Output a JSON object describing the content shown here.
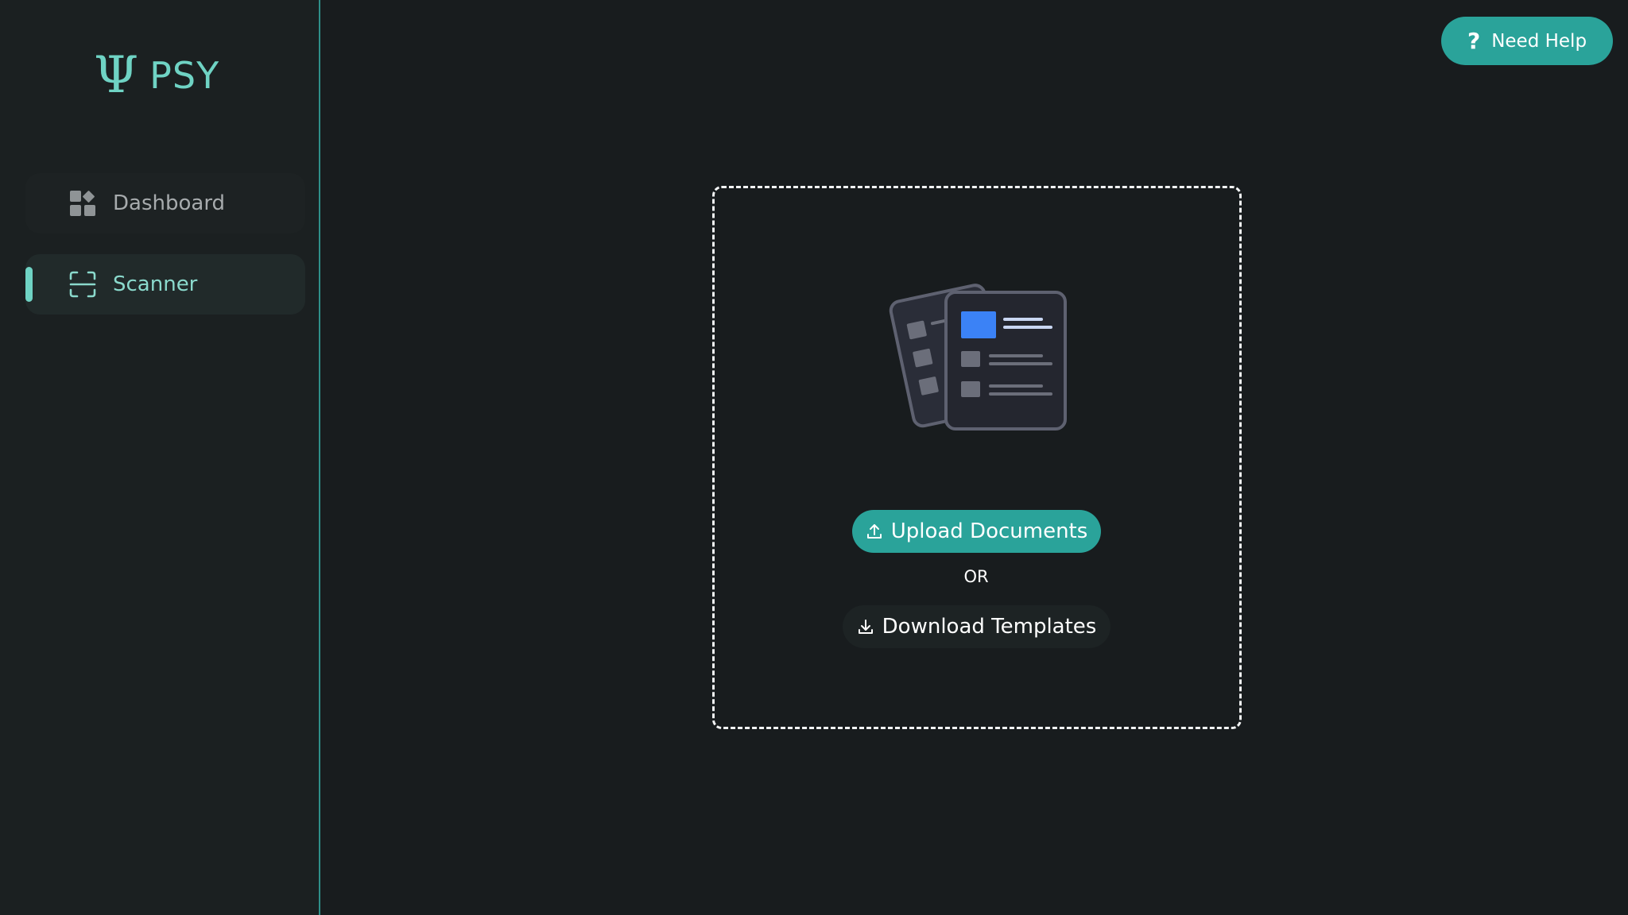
{
  "brand": {
    "symbol": "Ψ",
    "name": "PSY"
  },
  "sidebar": {
    "items": [
      {
        "label": "Dashboard",
        "icon": "dashboard-icon",
        "active": false
      },
      {
        "label": "Scanner",
        "icon": "scan-icon",
        "active": true
      }
    ]
  },
  "header": {
    "help_label": "Need Help",
    "help_icon": "question-icon"
  },
  "main": {
    "upload_label": "Upload Documents",
    "or_text": "OR",
    "download_label": "Download Templates"
  },
  "colors": {
    "accent": "#2aa39a",
    "brand": "#6fd3c4",
    "background": "#181c1e",
    "sidebar": "#1b2021",
    "illustration_highlight": "#3b82f6"
  }
}
